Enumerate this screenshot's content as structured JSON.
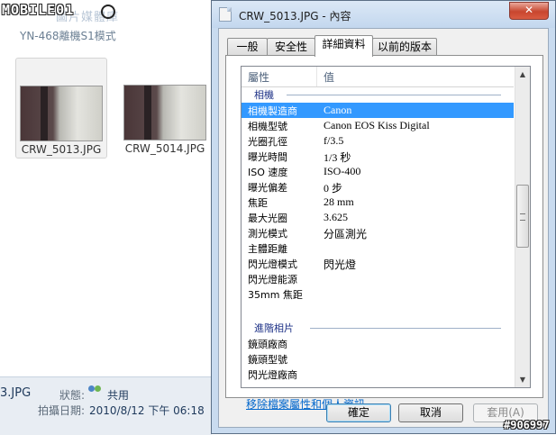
{
  "logo": {
    "text": "MOBILE01"
  },
  "explorer": {
    "title": "圖片媒體庫",
    "path": "YN-468離機S1模式",
    "thumbnails": [
      {
        "name": "CRW_5013.JPG",
        "selected": true
      },
      {
        "name": "CRW_5014.JPG",
        "selected": false
      }
    ],
    "details": {
      "filename": "3.JPG",
      "status_label": "狀態:",
      "status_value": "共用",
      "date_label": "拍攝日期:",
      "date_value": "2010/8/12 下午 06:18"
    }
  },
  "dialog": {
    "title": "CRW_5013.JPG - 內容",
    "close_label": "✕",
    "tabs": [
      {
        "label": "一般",
        "active": false
      },
      {
        "label": "安全性",
        "active": false
      },
      {
        "label": "詳細資料",
        "active": true
      },
      {
        "label": "以前的版本",
        "active": false
      }
    ],
    "columns": {
      "property": "屬性",
      "value": "值"
    },
    "group_camera": "相機",
    "rows": [
      {
        "key": "相機製造商",
        "value": "Canon",
        "selected": true
      },
      {
        "key": "相機型號",
        "value": "Canon EOS Kiss Digital"
      },
      {
        "key": "光圈孔徑",
        "value": "f/3.5"
      },
      {
        "key": "曝光時間",
        "value": "1/3 秒"
      },
      {
        "key": "ISO 速度",
        "value": "ISO-400"
      },
      {
        "key": "曝光偏差",
        "value": "0 步"
      },
      {
        "key": "焦距",
        "value": "28 mm"
      },
      {
        "key": "最大光圈",
        "value": "3.625"
      },
      {
        "key": "測光模式",
        "value": "分區測光"
      },
      {
        "key": "主體距離",
        "value": ""
      },
      {
        "key": "閃光燈模式",
        "value": "閃光燈"
      },
      {
        "key": "閃光燈能源",
        "value": ""
      },
      {
        "key": "35mm 焦距",
        "value": ""
      }
    ],
    "group_advanced": "進階相片",
    "rows2": [
      {
        "key": "鏡頭廠商",
        "value": ""
      },
      {
        "key": "鏡頭型號",
        "value": ""
      },
      {
        "key": "閃光燈廠商",
        "value": ""
      }
    ],
    "remove_link": "移除檔案屬性和個人資訊",
    "buttons": {
      "ok": "確定",
      "cancel": "取消",
      "apply": "套用(A)"
    }
  },
  "watermark": "#906997",
  "colors": {
    "selection": "#3399ff",
    "link": "#0066cc",
    "group": "#1e3287"
  }
}
